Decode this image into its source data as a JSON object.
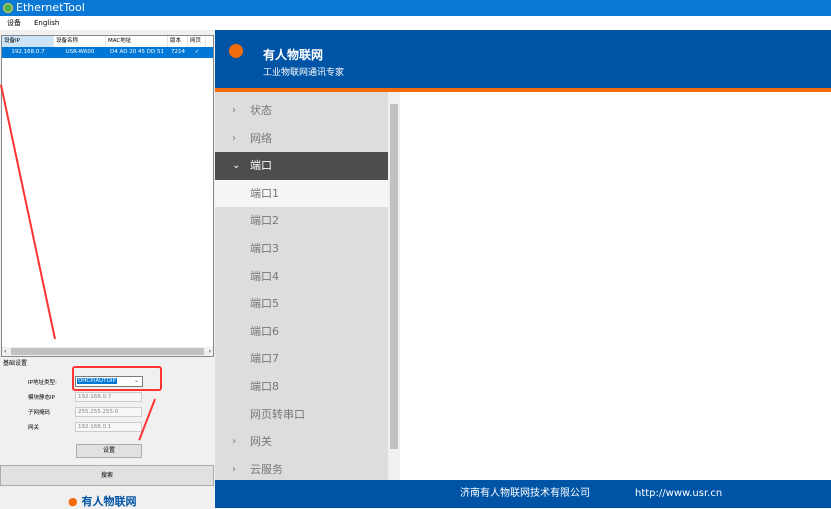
{
  "window": {
    "title": "EthernetTool"
  },
  "menu": [
    "设备",
    "English"
  ],
  "table": {
    "headers": [
      "设备IP",
      "设备名称",
      "MAC地址",
      "版本",
      "网页"
    ],
    "rows": [
      [
        "192.168.0.7",
        "USR-W600",
        "D4 AD 20 45 DD 51",
        "7214",
        "✓"
      ]
    ]
  },
  "settings": {
    "group": "基础设置",
    "ip_type_label": "IP地址类型:",
    "ip_type_value": "DHCP/AUTOIP",
    "static_ip_label": "模块静态IP",
    "static_ip": "192.168.0.7",
    "mask_label": "子网掩码",
    "mask": "255.255.255.0",
    "gateway_label": "网关",
    "gateway": "192.168.0.1",
    "set_button": "设置"
  },
  "search_button": "搜索",
  "bottom_logo": "有人物联网",
  "web": {
    "brand": "有人物联网",
    "slogan": "工业物联网通讯专家",
    "nav": [
      "状态",
      "网络",
      "端口",
      "端口1",
      "端口2",
      "端口3",
      "端口4",
      "端口5",
      "端口6",
      "端口7",
      "端口8",
      "网页转串口",
      "网关",
      "云服务"
    ],
    "footer_company": "济南有人物联网技术有限公司",
    "footer_url": "http://www.usr.cn"
  }
}
